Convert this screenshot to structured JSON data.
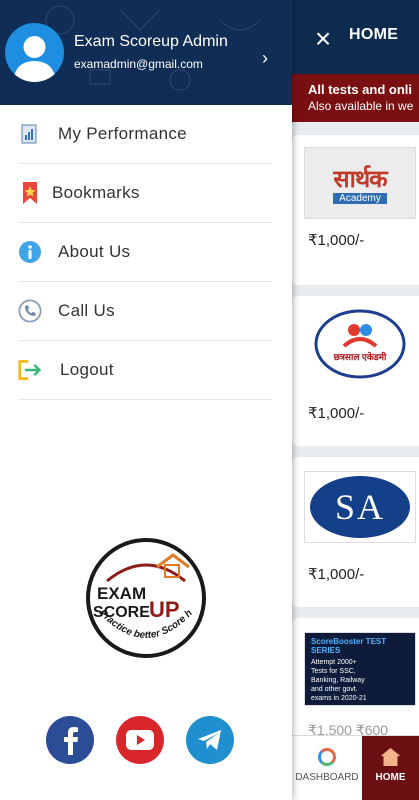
{
  "background": {
    "header_title": "HOME",
    "banner": {
      "line1": "All tests and onli",
      "line2": "Also available in we"
    },
    "cards": [
      {
        "brand_main": "सार्थक",
        "brand_sub": "Academy",
        "price": "₹1,000/-"
      },
      {
        "brand_main": "छत्रसाल एकेडमी",
        "price": "₹1,000/-"
      },
      {
        "brand_main": "SA",
        "price": "₹1,000/-"
      },
      {
        "brand_main": "ScoreBooster TEST SERIES",
        "brand_sub": "Attempt 2000+ Tests for SSC, Banking, Railway and other govt. exams in 2020-21",
        "price": "₹1,500 ₹600"
      }
    ],
    "tabs": {
      "dashboard": "DASHBOARD",
      "home": "HOME"
    }
  },
  "drawer": {
    "user_name": "Exam Scoreup Admin",
    "user_email": "examadmin@gmail.com",
    "menu": [
      {
        "label": "My Performance",
        "icon": "performance-icon"
      },
      {
        "label": "Bookmarks",
        "icon": "bookmark-icon"
      },
      {
        "label": "About Us",
        "icon": "info-icon"
      },
      {
        "label": "Call Us",
        "icon": "phone-icon"
      },
      {
        "label": "Logout",
        "icon": "logout-icon"
      }
    ],
    "logo": {
      "line1": "EXAM",
      "line2": "SCORE",
      "line3": "UP",
      "tagline": "Practice better Score higher"
    },
    "social": [
      "facebook-icon",
      "youtube-icon",
      "telegram-icon"
    ]
  },
  "colors": {
    "header": "#0f2d55",
    "banner": "#7a0f12",
    "home_tab": "#6b0f12"
  }
}
